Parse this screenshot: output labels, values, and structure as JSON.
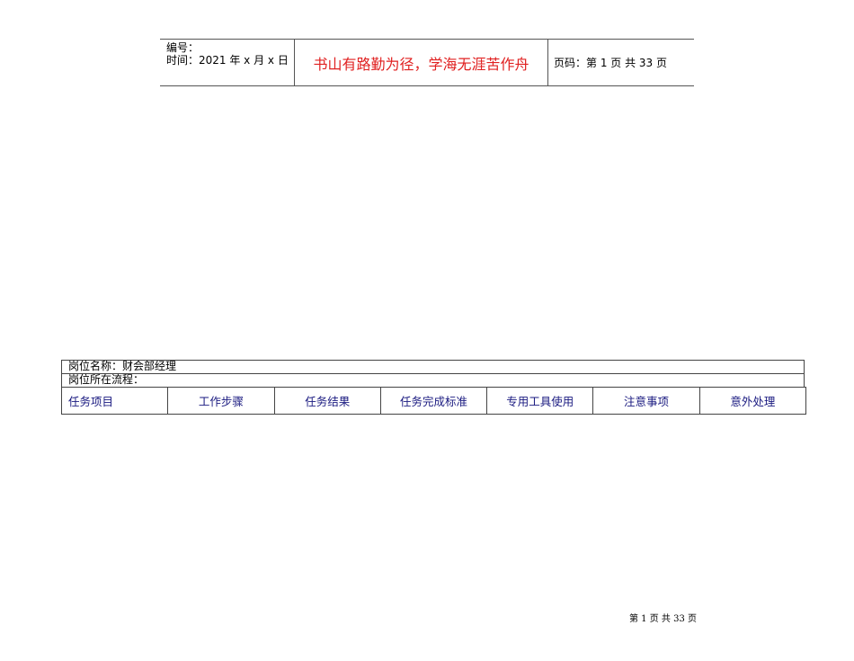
{
  "header": {
    "number_label": "编号：",
    "time_label": "时间：2021 年 x 月 x 日",
    "motto": "书山有路勤为径，学海无涯苦作舟",
    "page_info": "页码：第 1 页  共 33 页"
  },
  "form": {
    "position_name": "岗位名称：财会部经理",
    "position_process": "岗位所在流程：",
    "columns": [
      "任务项目",
      "工作步骤",
      "任务结果",
      "任务完成标准",
      "专用工具使用",
      "注意事项",
      "意外处理"
    ]
  },
  "footer": {
    "page": "第 1 页 共 33 页"
  }
}
